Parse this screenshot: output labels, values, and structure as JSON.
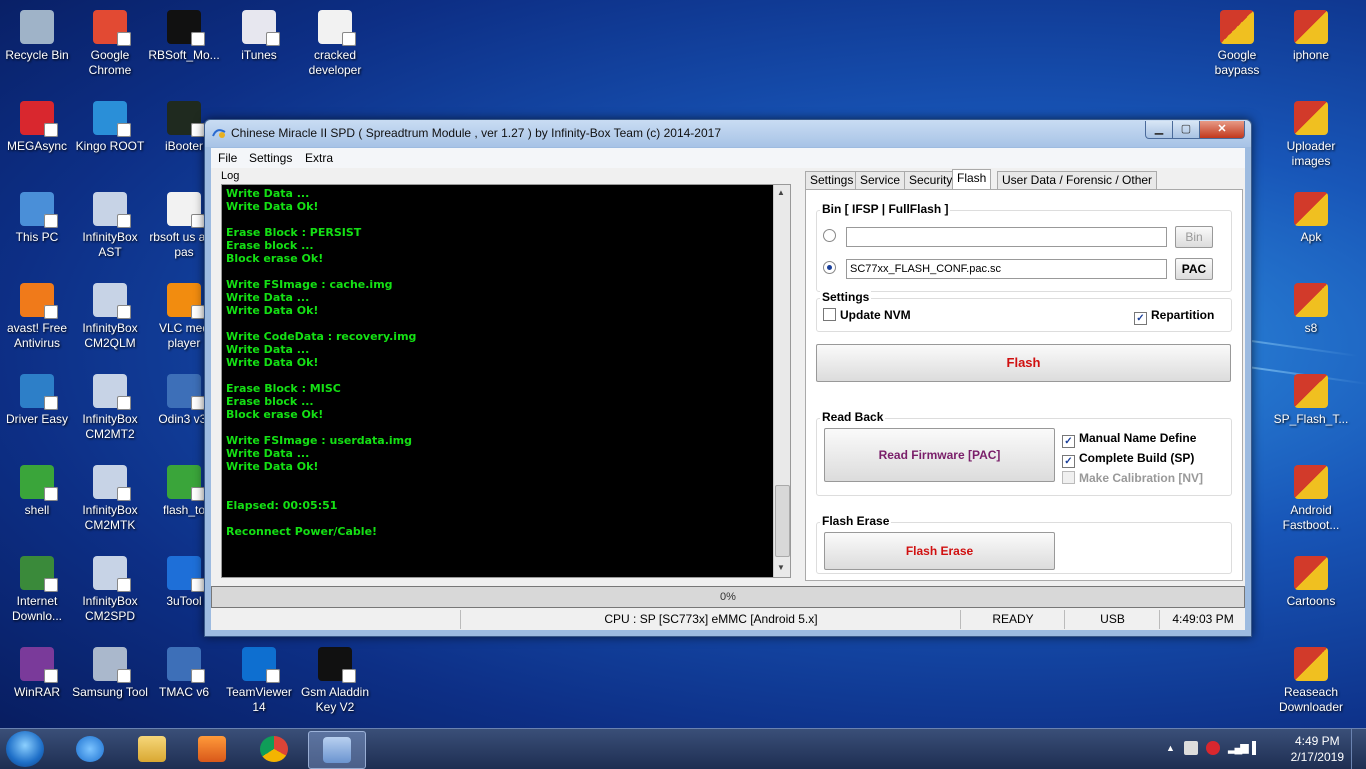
{
  "desktop": {
    "left_icons": [
      {
        "label": "Recycle Bin",
        "icon": "recycle-bin-icon",
        "color": "#9fb3c8"
      },
      {
        "label": "Google Chrome",
        "icon": "chrome-icon",
        "color": "#e24a33"
      },
      {
        "label": "RBSoft_Mo...",
        "icon": "rbsoft-icon",
        "color": "#111111"
      },
      {
        "label": "iTunes",
        "icon": "itunes-icon",
        "color": "#e7e7ef"
      },
      {
        "label": "cracked developer",
        "icon": "file-icon",
        "color": "#f2f2f2"
      },
      {
        "label": "MEGAsync",
        "icon": "megasync-icon",
        "color": "#d9272e"
      },
      {
        "label": "Kingo ROOT",
        "icon": "kingo-icon",
        "color": "#2a8fd8"
      },
      {
        "label": "iBooter",
        "icon": "ibooter-icon",
        "color": "#1f2a1f"
      },
      {
        "label": "This PC",
        "icon": "computer-icon",
        "color": "#4a8fd8"
      },
      {
        "label": "InfinityBox AST",
        "icon": "infinitybox-icon",
        "color": "#c7d3e6"
      },
      {
        "label": "rbsoft us and pas",
        "icon": "file-icon",
        "color": "#f2f2f2"
      },
      {
        "label": "avast! Free Antivirus",
        "icon": "avast-icon",
        "color": "#f07a1a"
      },
      {
        "label": "InfinityBox CM2QLM",
        "icon": "infinitybox-icon",
        "color": "#c7d3e6"
      },
      {
        "label": "VLC med player",
        "icon": "vlc-icon",
        "color": "#f28c0f"
      },
      {
        "label": "Driver Easy",
        "icon": "drivereasy-icon",
        "color": "#2d7fc8"
      },
      {
        "label": "InfinityBox CM2MT2",
        "icon": "infinitybox-icon",
        "color": "#c7d3e6"
      },
      {
        "label": "Odin3 v3.",
        "icon": "odin-icon",
        "color": "#3d6fb8"
      },
      {
        "label": "shell",
        "icon": "shell-icon",
        "color": "#3aa53a"
      },
      {
        "label": "InfinityBox CM2MTK",
        "icon": "infinitybox-icon",
        "color": "#c7d3e6"
      },
      {
        "label": "flash_to",
        "icon": "flashtool-icon",
        "color": "#3aa53a"
      },
      {
        "label": "Internet Downlo...",
        "icon": "idm-icon",
        "color": "#3a8a3a"
      },
      {
        "label": "InfinityBox CM2SPD",
        "icon": "infinitybox-icon",
        "color": "#c7d3e6"
      },
      {
        "label": "3uTool",
        "icon": "3utools-icon",
        "color": "#1e6fd8"
      },
      {
        "label": "WinRAR",
        "icon": "winrar-icon",
        "color": "#7a3a9a"
      },
      {
        "label": "Samsung Tool",
        "icon": "samsungtool-icon",
        "color": "#aab8cc"
      },
      {
        "label": "TMAC v6",
        "icon": "tmac-icon",
        "color": "#3d6fb8"
      },
      {
        "label": "TeamViewer 14",
        "icon": "teamviewer-icon",
        "color": "#0e6fd0"
      },
      {
        "label": "Gsm Aladdin Key V2",
        "icon": "gsmaladdin-icon",
        "color": "#111111"
      }
    ],
    "right_icons": [
      {
        "label": "Google baypass",
        "icon": "winrar-archive-icon",
        "color": "#d23a2a"
      },
      {
        "label": "iphone",
        "icon": "winrar-archive-icon",
        "color": "#d23a2a"
      },
      {
        "label": "Uploader images",
        "icon": "winrar-archive-icon",
        "color": "#d23a2a"
      },
      {
        "label": "Apk",
        "icon": "winrar-archive-icon",
        "color": "#d23a2a"
      },
      {
        "label": "s8",
        "icon": "winrar-archive-icon",
        "color": "#d23a2a"
      },
      {
        "label": "SP_Flash_T...",
        "icon": "winrar-archive-icon",
        "color": "#d23a2a"
      },
      {
        "label": "Android Fastboot...",
        "icon": "winrar-archive-icon",
        "color": "#d23a2a"
      },
      {
        "label": "Cartoons",
        "icon": "winrar-archive-icon",
        "color": "#d23a2a"
      },
      {
        "label": "Reaseach Downloader",
        "icon": "winrar-archive-icon",
        "color": "#d23a2a"
      }
    ]
  },
  "window": {
    "title": "Chinese Miracle II SPD ( Spreadtrum Module , ver 1.27 ) by Infinity-Box Team (c) 2014-2017",
    "min_glyph": "▁",
    "max_glyph": "▢",
    "close_glyph": "✕"
  },
  "menu": [
    "File",
    "Settings",
    "Extra"
  ],
  "log": {
    "label": "Log",
    "lines": "Write Data ...\nWrite Data Ok!\n\nErase Block : PERSIST\nErase block ...\nBlock erase Ok!\n\nWrite FSImage : cache.img\nWrite Data ...\nWrite Data Ok!\n\nWrite CodeData : recovery.img\nWrite Data ...\nWrite Data Ok!\n\nErase Block : MISC\nErase block ...\nBlock erase Ok!\n\nWrite FSImage : userdata.img\nWrite Data ...\nWrite Data Ok!\n\n\nElapsed: 00:05:51\n\nReconnect Power/Cable!"
  },
  "tabs": [
    "Settings",
    "Service",
    "Security",
    "Flash",
    "User Data / Forensic / Other"
  ],
  "flash": {
    "bin_group_title": "Bin  [ IFSP | FullFlash ]",
    "bin_value": "",
    "bin_button": "Bin",
    "pac_value": "SC77xx_FLASH_CONF.pac.sc",
    "pac_button": "PAC",
    "settings_title": "Settings",
    "update_nvm": "Update NVM",
    "repartition": "Repartition",
    "flash_button": "Flash",
    "readback_title": "Read Back",
    "read_firmware_button": "Read Firmware [PAC]",
    "manual_name": "Manual Name Define",
    "complete_build": "Complete Build (SP)",
    "make_calibration": "Make Calibration [NV]",
    "erase_title": "Flash Erase",
    "erase_button": "Flash Erase",
    "check_glyph": "✓",
    "accent_red": "#d01010",
    "accent_purple": "#7a1f6a"
  },
  "progress": {
    "text": "0%",
    "value": 0
  },
  "status": {
    "cpu": "CPU : SP [SC773x] eMMC [Android 5.x]",
    "state": "READY",
    "conn": "USB",
    "time": "4:49:03 PM"
  },
  "taskbar": {
    "clock_time": "4:49 PM",
    "clock_date": "2/17/2019",
    "tray_up": "▲",
    "signal": "▂▄▆"
  }
}
